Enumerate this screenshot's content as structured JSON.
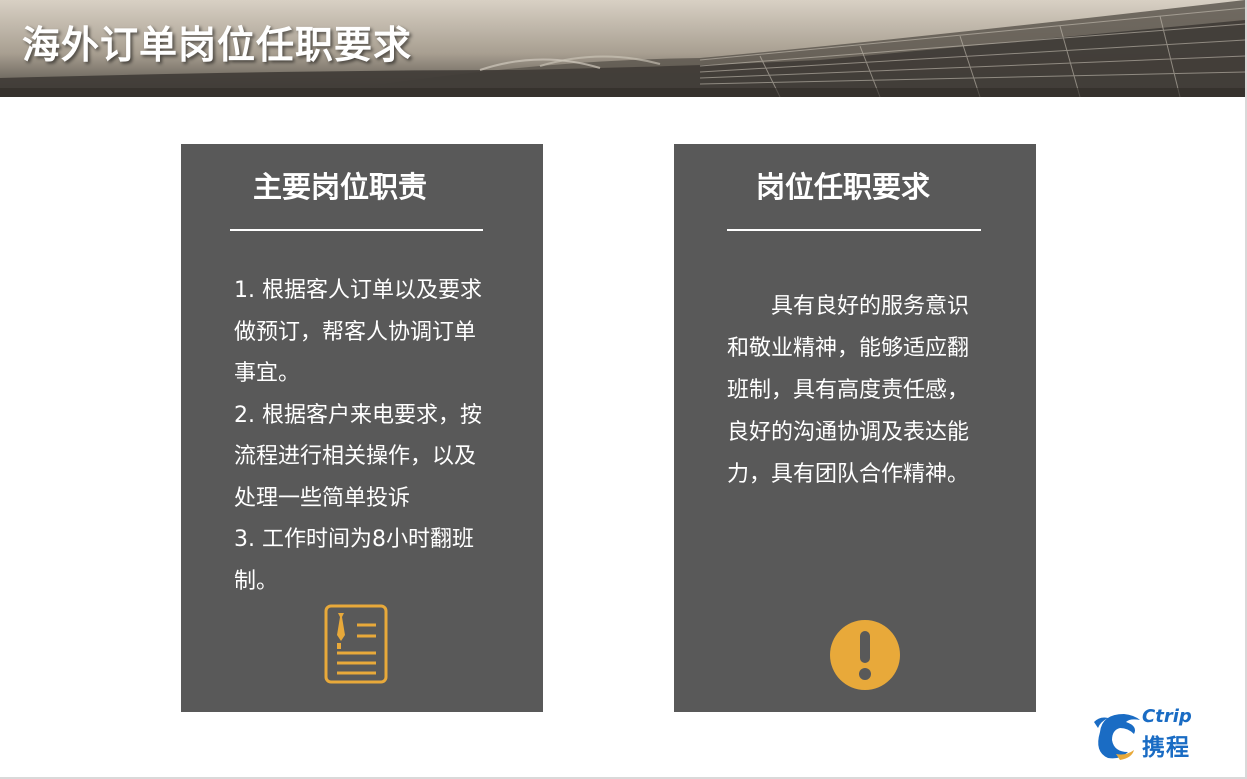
{
  "slide": {
    "title": "海外订单岗位任职要求"
  },
  "left_card": {
    "title": "主要岗位职责",
    "lines": [
      "1. 根据客人订单以及要求做预订，帮客人协调订单事宜。",
      "2. 根据客户来电要求，按流程进行相关操作，以及处理一些简单投诉",
      "3. 工作时间为8小时翻班制。"
    ],
    "icon": "document-tie-icon"
  },
  "right_card": {
    "title": "岗位任职要求",
    "body": "具有良好的服务意识和敬业精神，能够适应翻班制，具有高度责任感，良好的沟通协调及表达能力，具有团队合作精神。",
    "icon": "exclamation-icon"
  },
  "logo": {
    "word": "Ctrip",
    "chinese": "携程"
  },
  "colors": {
    "card_bg": "#595959",
    "icon_accent": "#e8a93a",
    "logo_blue": "#1a6cc4",
    "text": "#ffffff"
  }
}
